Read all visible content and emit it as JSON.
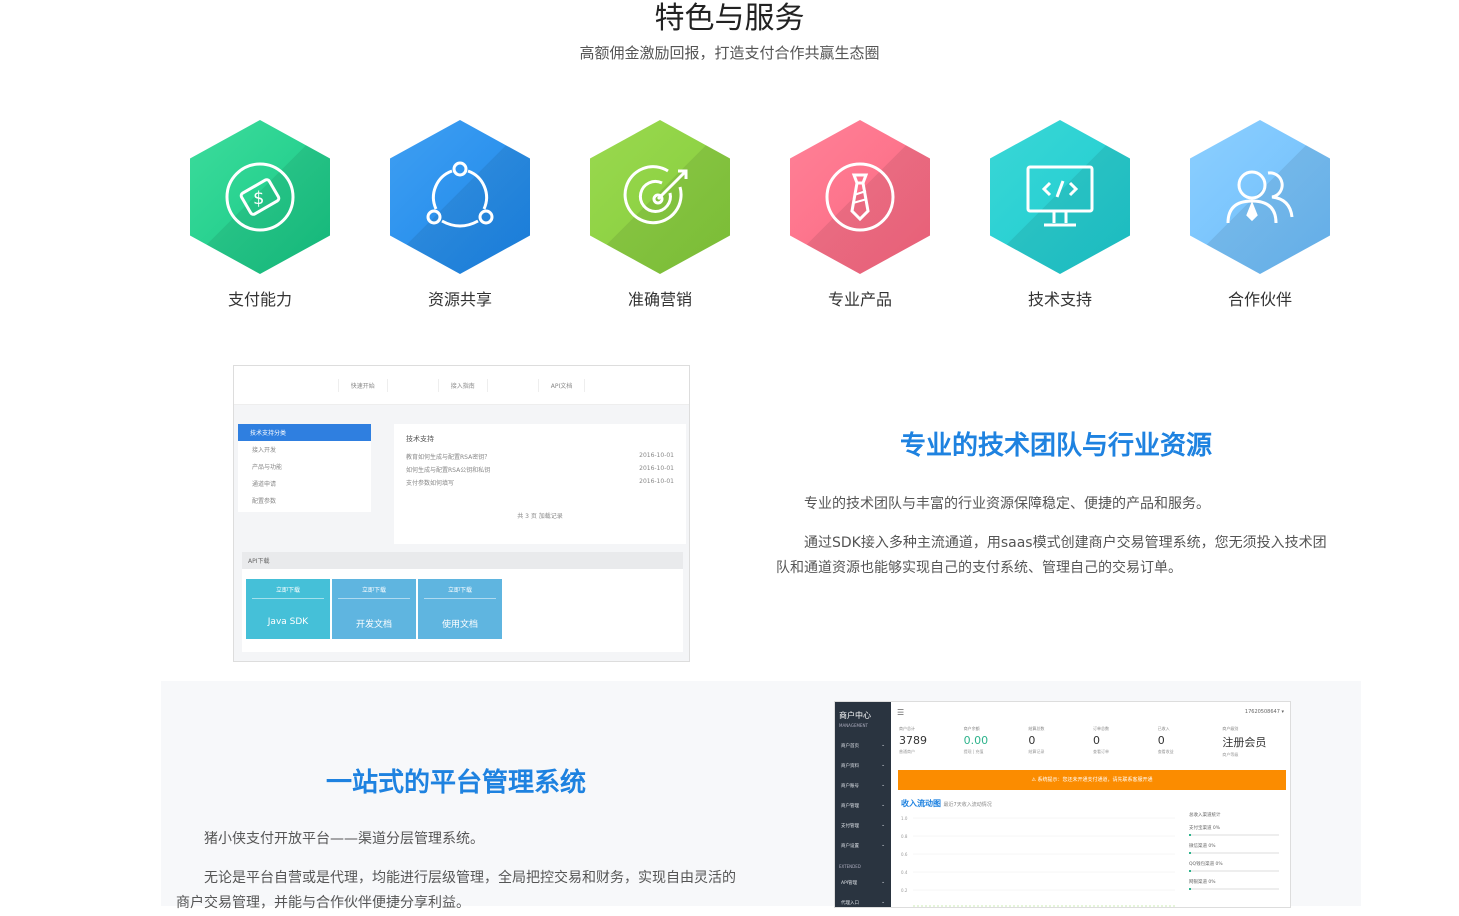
{
  "header": {
    "title": "特色与服务",
    "subtitle": "高额佣金激励回报，打造支付合作共赢生态圈"
  },
  "features": [
    {
      "label": "支付能力",
      "icon": "money-icon",
      "color_a": "#3ddc9c",
      "color_b": "#14c784"
    },
    {
      "label": "资源共享",
      "icon": "share-icon",
      "color_a": "#3f9ff2",
      "color_b": "#1a86ea"
    },
    {
      "label": "准确营销",
      "icon": "target-icon",
      "color_a": "#9ad94f",
      "color_b": "#84cc3a"
    },
    {
      "label": "专业产品",
      "icon": "tie-icon",
      "color_a": "#ff8197",
      "color_b": "#fb6680"
    },
    {
      "label": "技术支持",
      "icon": "code-monitor-icon",
      "color_a": "#3ad7d6",
      "color_b": "#1ccbd0"
    },
    {
      "label": "合作伙伴",
      "icon": "users-icon",
      "color_a": "#8ccfff",
      "color_b": "#6bbcfb"
    }
  ],
  "shot1": {
    "tabs": [
      "快速开始",
      "接入指南",
      "API文档"
    ],
    "side_items": [
      "技术支持分类",
      "接入开发",
      "产品与功能",
      "通道申请",
      "配置参数"
    ],
    "main_title": "技术支持",
    "rows": [
      {
        "q": "教育如何生成与配置RSA密钥？",
        "d": "2016-10-01"
      },
      {
        "q": "如何生成与配置RSA公钥和私钥",
        "d": "2016-10-01"
      },
      {
        "q": "支付参数如何填写",
        "d": "2016-10-01"
      }
    ],
    "more": "共 3 页 加载记录",
    "api_bar": "API下载",
    "downloads": [
      {
        "top": "立即下载",
        "name": "Java SDK"
      },
      {
        "top": "立即下载",
        "name": "开发文档"
      },
      {
        "top": "立即下载",
        "name": "使用文档"
      }
    ]
  },
  "section1": {
    "title": "专业的技术团队与行业资源",
    "p1": "专业的技术团队与丰富的行业资源保障稳定、便捷的产品和服务。",
    "p2": "通过SDK接入多种主流通道，用saas模式创建商户交易管理系统，您无须投入技术团队和通道资源也能够实现自己的支付系统、管理自己的交易订单。"
  },
  "section2": {
    "title": "一站式的平台管理系统",
    "p1": "猪小侠支付开放平台——渠道分层管理系统。",
    "p2": "无论是平台自营或是代理，均能进行层级管理，全局把控交易和财务，实现自由灵活的商户交易管理，并能与合作伙伴便捷分享利益。"
  },
  "shot2": {
    "brand": "商户中心",
    "brand_sub": "MANAGEMENT",
    "menu": [
      "商户首页",
      "商户资料",
      "商户账号",
      "商户管理",
      "支付管理",
      "商户设置"
    ],
    "ext": "EXTENDED",
    "ext_menu": [
      "API管理",
      "代理入口"
    ],
    "user": "17620508647 ▾",
    "stats": [
      {
        "k": "商户总计",
        "v": "3789",
        "s": "普通商户"
      },
      {
        "k": "商户余额",
        "v": "0.00",
        "s": "提现 | 充值"
      },
      {
        "k": "结算总数",
        "v": "0",
        "s": "结算记录"
      },
      {
        "k": "订单总数",
        "v": "0",
        "s": "查看订单"
      },
      {
        "k": "已收入",
        "v": "0",
        "s": "查看收益"
      },
      {
        "k": "商户级别",
        "v": "注册会员",
        "s": "商户等级"
      }
    ],
    "warning": "⚠ 系统提示：您还未开通支付通道，请先联系客服开通",
    "chart_title": "收入流动图",
    "chart_sub": "最近7天收入流动情况",
    "chart_y": [
      "1.0",
      "0.8",
      "0.6",
      "0.4",
      "0.2"
    ],
    "right_title": "总收入渠道统计",
    "right_items": [
      "支付宝渠道 0%",
      "微信渠道 0%",
      "QQ钱包渠道 0%",
      "网银渠道 0%"
    ]
  }
}
